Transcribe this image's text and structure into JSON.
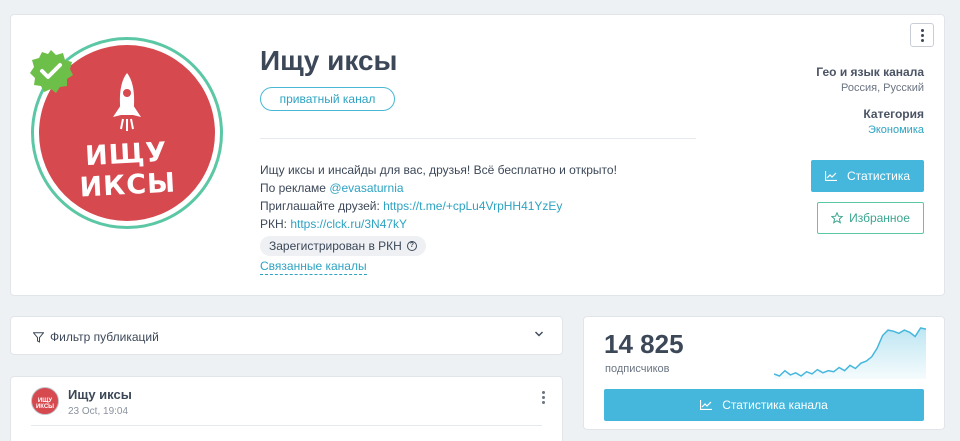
{
  "channel": {
    "title": "Ищу иксы",
    "avatar_text": "ИЩУ ИКСЫ",
    "privacy_badge": "приватный канал",
    "description": {
      "line1": "Ищу иксы и инсайды для вас, друзья! Всё бесплатно и открыто!",
      "ads_prefix": "По рекламе ",
      "ads_handle": "@evasaturnia",
      "invite_prefix": "Приглашайте друзей: ",
      "invite_link": "https://t.me/+cpLu4VrpHH41YzEy",
      "rkn_prefix": "РКН: ",
      "rkn_link": "https://clck.ru/3N47kY"
    },
    "rkn_badge": "Зарегистрирован в РКН",
    "related_link": "Связанные каналы",
    "geo_label": "Гео и язык канала",
    "geo_value": "Россия, Русский",
    "category_label": "Категория",
    "category_value": "Экономика",
    "stats_button": "Статистика",
    "favorite_button": "Избранное"
  },
  "filter": {
    "label": "Фильтр публикаций"
  },
  "post": {
    "author": "Ищу иксы",
    "time": "23 Oct, 19:04"
  },
  "subscribers": {
    "count": "14 825",
    "label": "подписчиков",
    "button": "Статистика канала",
    "trend": [
      6,
      4,
      9,
      5,
      7,
      4,
      8,
      6,
      10,
      7,
      9,
      8,
      12,
      9,
      14,
      11,
      16,
      18,
      22,
      30,
      42,
      47,
      46,
      44,
      47,
      45,
      41,
      49,
      48
    ]
  },
  "colors": {
    "accent": "#45b7dc",
    "link": "#2da3c2",
    "verified": "#6cc04a",
    "avatar_red": "#d6494f",
    "ring_green": "#5cc7a4"
  },
  "icons": {
    "verified": "checkmark-badge-icon",
    "stats": "line-chart-icon",
    "favorite": "star-icon",
    "filter": "funnel-icon",
    "menu": "kebab-menu-icon",
    "help": "question-icon",
    "dropdown": "chevron-down-icon"
  }
}
